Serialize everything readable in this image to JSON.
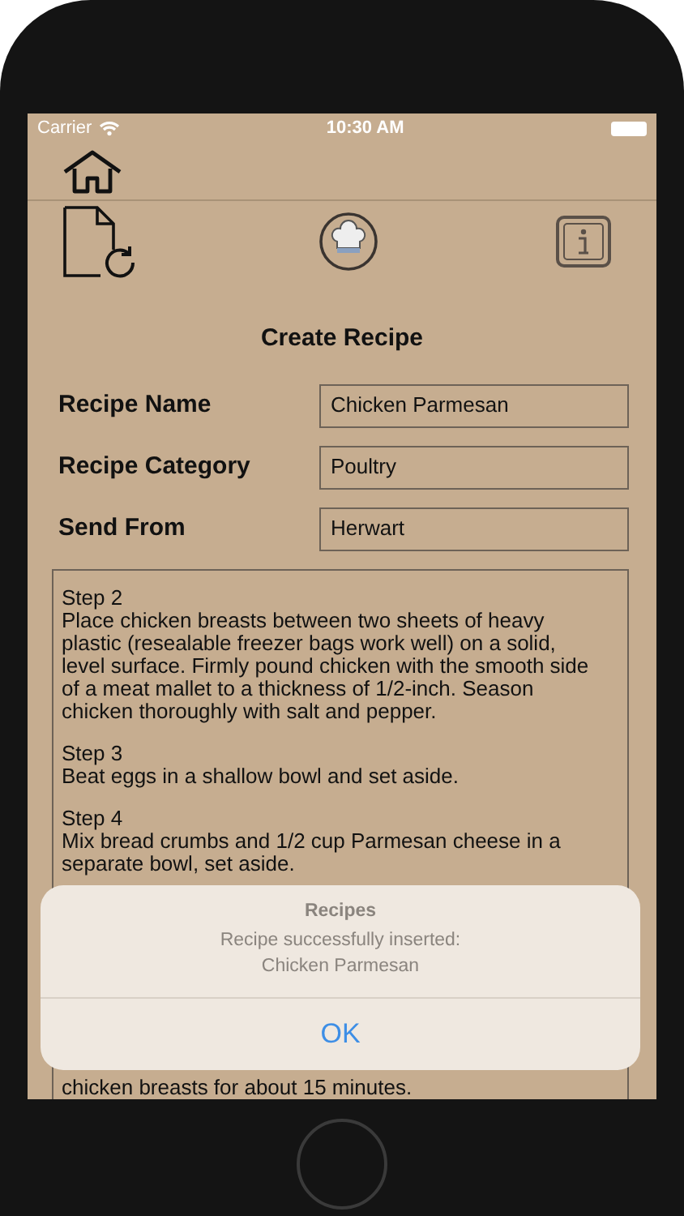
{
  "status_bar": {
    "carrier": "Carrier",
    "time": "10:30 AM"
  },
  "title": "Create Recipe",
  "fields": [
    {
      "label": "Recipe Name",
      "value": "Chicken Parmesan"
    },
    {
      "label": "Recipe Category",
      "value": "Poultry"
    },
    {
      "label": "Send From",
      "value": "Herwart"
    }
  ],
  "steps": [
    {
      "heading": "Step 2",
      "body": "Place chicken breasts between two sheets of heavy plastic (resealable freezer bags work well) on a solid, level surface. Firmly pound chicken with the smooth side of a meat mallet to a thickness of 1/2-inch. Season chicken thoroughly with salt and pepper."
    },
    {
      "heading": "Step 3",
      "body": "Beat eggs in a shallow bowl and set aside."
    },
    {
      "heading": "Step 4",
      "body": "Mix bread crumbs and 1/2 cup Parmesan cheese in a separate bowl, set aside."
    }
  ],
  "trailing_text": "chicken breasts for about 15 minutes.",
  "alert": {
    "title": "Recipes",
    "message": "Recipe successfully inserted:",
    "detail": "Chicken Parmesan",
    "button": "OK"
  }
}
